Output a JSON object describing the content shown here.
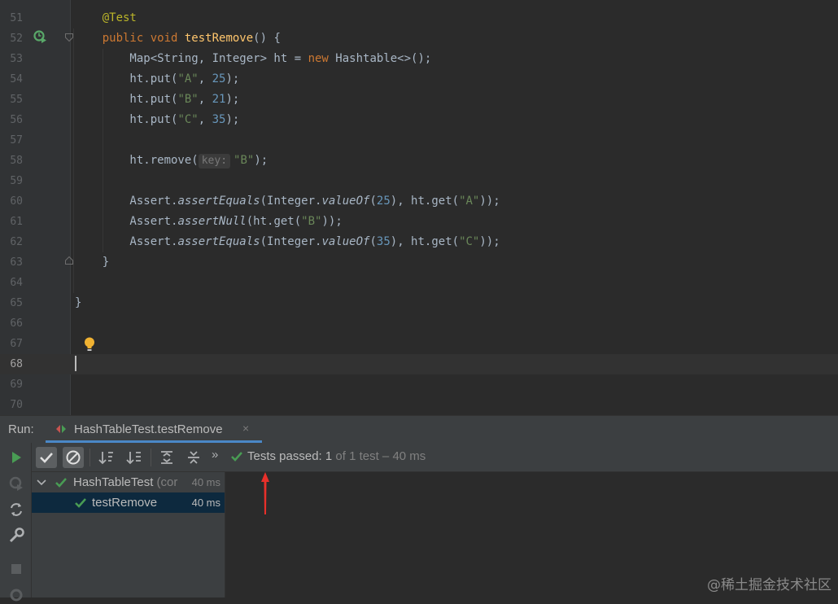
{
  "editor": {
    "lines": [
      {
        "num": "51",
        "parts": [
          {
            "t": "    "
          },
          {
            "t": "@Test",
            "c": "ann"
          }
        ]
      },
      {
        "num": "52",
        "parts": [
          {
            "t": "    "
          },
          {
            "t": "public void ",
            "c": "kw"
          },
          {
            "t": "testRemove",
            "c": "fn"
          },
          {
            "t": "() {"
          }
        ]
      },
      {
        "num": "53",
        "parts": [
          {
            "t": "        Map<String, Integer> ht = "
          },
          {
            "t": "new ",
            "c": "kw"
          },
          {
            "t": "Hashtable<>();"
          }
        ]
      },
      {
        "num": "54",
        "parts": [
          {
            "t": "        ht.put("
          },
          {
            "t": "\"A\"",
            "c": "str"
          },
          {
            "t": ", "
          },
          {
            "t": "25",
            "c": "num"
          },
          {
            "t": ");"
          }
        ]
      },
      {
        "num": "55",
        "parts": [
          {
            "t": "        ht.put("
          },
          {
            "t": "\"B\"",
            "c": "str"
          },
          {
            "t": ", "
          },
          {
            "t": "21",
            "c": "num"
          },
          {
            "t": ");"
          }
        ]
      },
      {
        "num": "56",
        "parts": [
          {
            "t": "        ht.put("
          },
          {
            "t": "\"C\"",
            "c": "str"
          },
          {
            "t": ", "
          },
          {
            "t": "35",
            "c": "num"
          },
          {
            "t": ");"
          }
        ]
      },
      {
        "num": "57",
        "parts": []
      },
      {
        "num": "58",
        "parts": [
          {
            "t": "        ht.remove("
          },
          {
            "t": "key:",
            "c": "hint"
          },
          {
            "t": "\"B\"",
            "c": "str"
          },
          {
            "t": ");"
          }
        ]
      },
      {
        "num": "59",
        "parts": []
      },
      {
        "num": "60",
        "parts": [
          {
            "t": "        Assert."
          },
          {
            "t": "assertEquals",
            "c": "it"
          },
          {
            "t": "(Integer."
          },
          {
            "t": "valueOf",
            "c": "it"
          },
          {
            "t": "("
          },
          {
            "t": "25",
            "c": "num"
          },
          {
            "t": "), ht.get("
          },
          {
            "t": "\"A\"",
            "c": "str"
          },
          {
            "t": "));"
          }
        ]
      },
      {
        "num": "61",
        "parts": [
          {
            "t": "        Assert."
          },
          {
            "t": "assertNull",
            "c": "it"
          },
          {
            "t": "(ht.get("
          },
          {
            "t": "\"B\"",
            "c": "str"
          },
          {
            "t": "));"
          }
        ]
      },
      {
        "num": "62",
        "parts": [
          {
            "t": "        Assert."
          },
          {
            "t": "assertEquals",
            "c": "it"
          },
          {
            "t": "(Integer."
          },
          {
            "t": "valueOf",
            "c": "it"
          },
          {
            "t": "("
          },
          {
            "t": "35",
            "c": "num"
          },
          {
            "t": "), ht.get("
          },
          {
            "t": "\"C\"",
            "c": "str"
          },
          {
            "t": "));"
          }
        ]
      },
      {
        "num": "63",
        "parts": [
          {
            "t": "    }"
          }
        ]
      },
      {
        "num": "64",
        "parts": []
      },
      {
        "num": "65",
        "parts": [
          {
            "t": "}"
          }
        ]
      },
      {
        "num": "66",
        "parts": []
      },
      {
        "num": "67",
        "parts": []
      },
      {
        "num": "68",
        "parts": [],
        "current": true
      },
      {
        "num": "69",
        "parts": []
      },
      {
        "num": "70",
        "parts": []
      }
    ]
  },
  "run_panel": {
    "label": "Run:",
    "tab_title": "HashTableTest.testRemove",
    "tab_close": "×",
    "more_glyph": "»",
    "status_main": "Tests passed: ",
    "status_count": "1",
    "status_detail": " of 1 test – 40 ms"
  },
  "tree": {
    "root_label": "HashTableTest",
    "root_suffix": " (cor",
    "root_time": "40 ms",
    "child_label": "testRemove",
    "child_time": "40 ms"
  },
  "watermark": "@稀土掘金技术社区",
  "colors": {
    "accent": "#4a88c7",
    "pass_green": "#499c54",
    "run_green": "#59a869",
    "arrow_red": "#e8302a",
    "bulb_yellow": "#f0b232"
  },
  "icons": [
    "run-gutter-icon",
    "fold-icon",
    "lightbulb-icon",
    "run-icon",
    "rerun-icon",
    "wrench-icon",
    "stop-icon",
    "show-passed-icon",
    "show-ignored-icon",
    "sort-alpha-icon",
    "sort-duration-icon",
    "expand-all-icon",
    "collapse-all-icon",
    "check-icon"
  ]
}
